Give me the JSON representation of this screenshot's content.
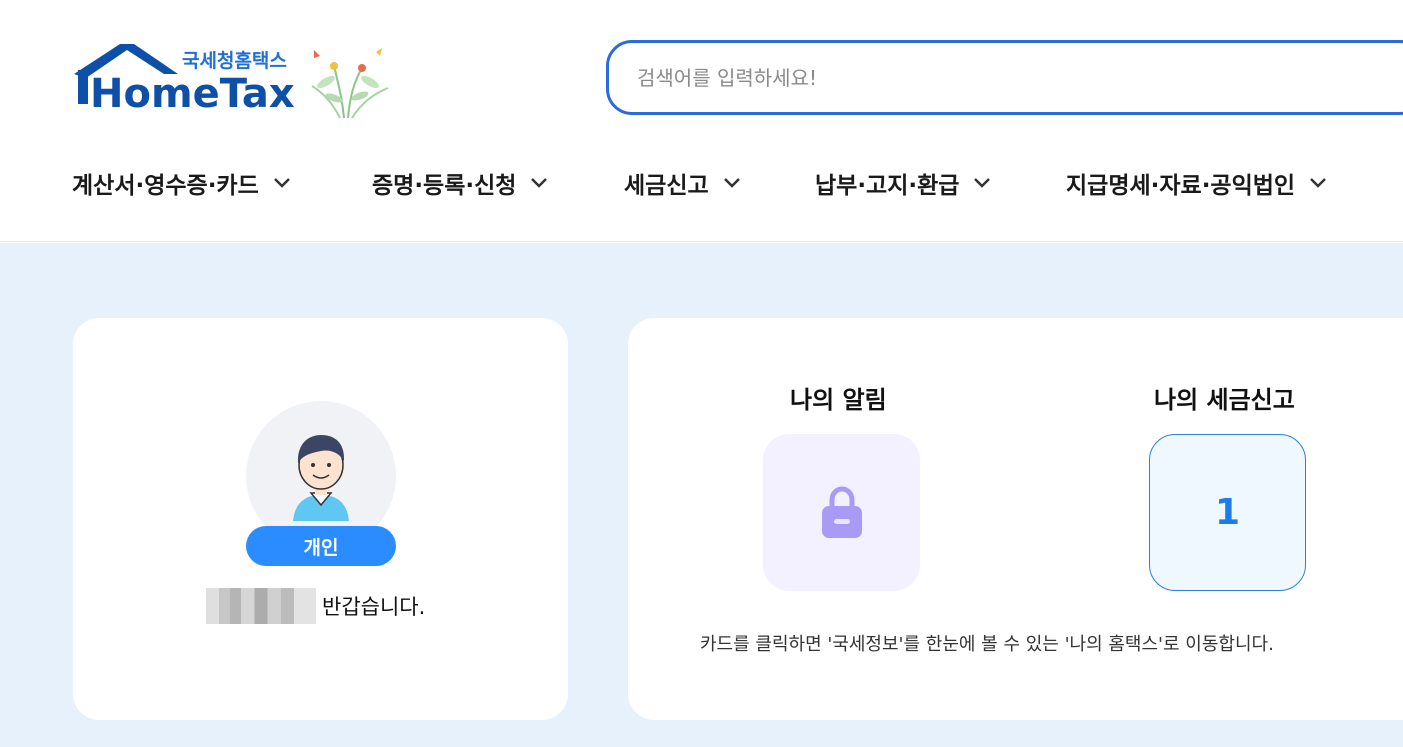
{
  "logo": {
    "sub_text": "국세청홈택스",
    "main_text": "HomeTax"
  },
  "search": {
    "placeholder": "검색어를 입력하세요!"
  },
  "nav": {
    "items": [
      {
        "label": "계산서·영수증·카드"
      },
      {
        "label": "증명·등록·신청"
      },
      {
        "label": "세금신고"
      },
      {
        "label": "납부·고지·환급"
      },
      {
        "label": "지급명세·자료·공익법인"
      }
    ]
  },
  "profile": {
    "badge": "개인",
    "greeting": "반갑습니다."
  },
  "my_menu": {
    "alarm_title": "나의 알림",
    "tax_title": "나의 세금신고",
    "tax_count": "1",
    "note": "카드를 클릭하면 '국세정보'를 한눈에 볼 수 있는 '나의 홈택스'로 이동합니다."
  },
  "colors": {
    "accent": "#2b6be0",
    "brand": "#0e4fa8",
    "badge": "#2b8cff",
    "background": "#e6f1fb"
  }
}
